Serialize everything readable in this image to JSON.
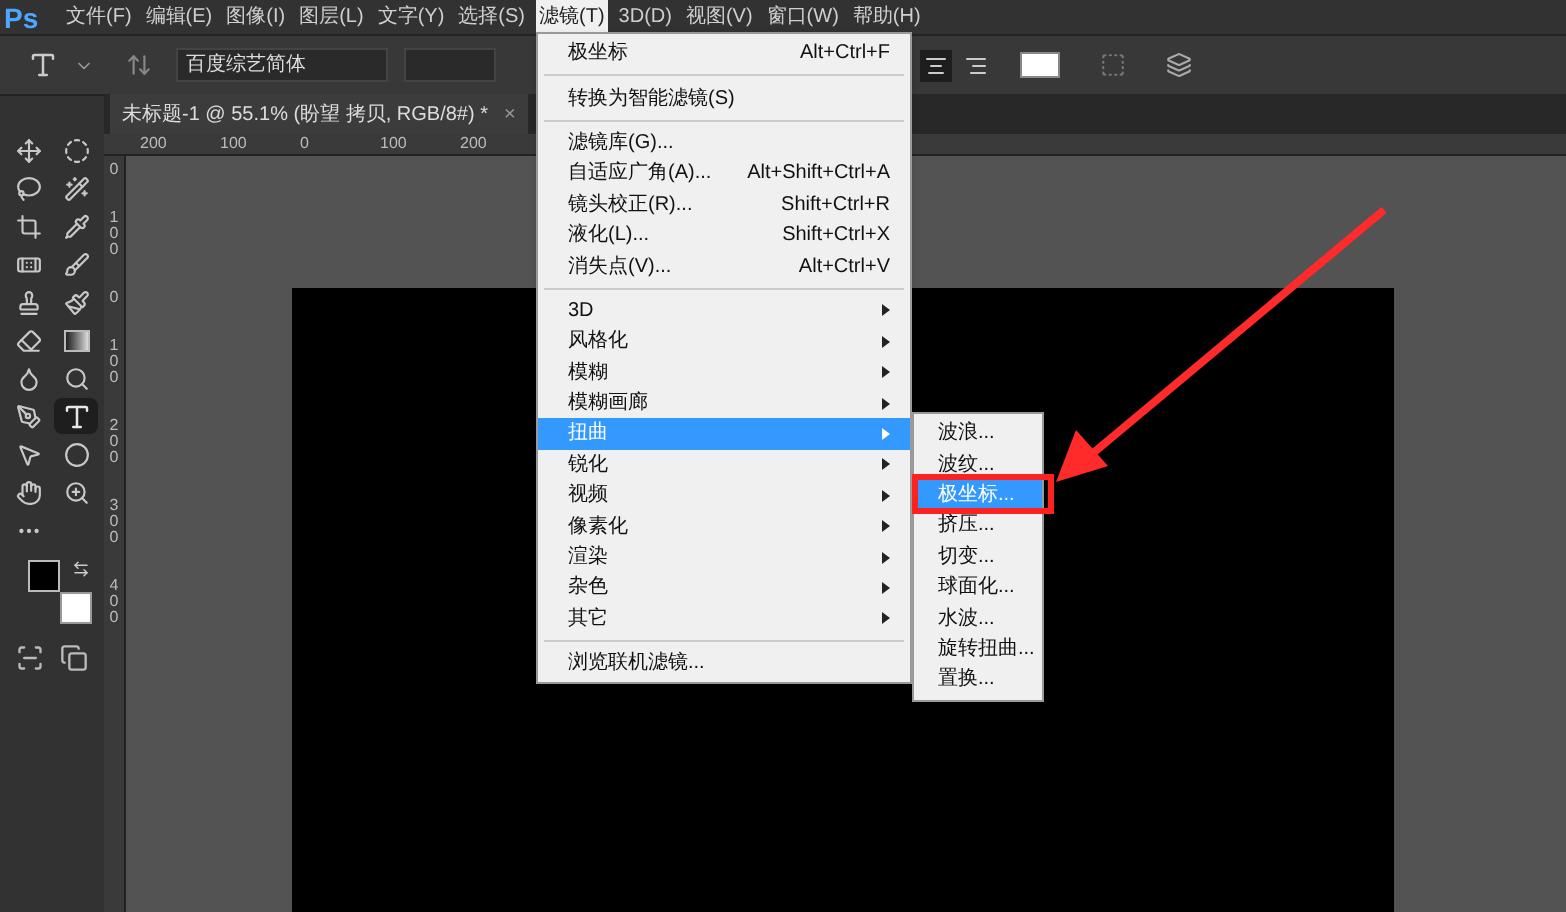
{
  "app_logo": "Ps",
  "menu_bar": [
    {
      "label": "文件(F)",
      "selected": false
    },
    {
      "label": "编辑(E)",
      "selected": false
    },
    {
      "label": "图像(I)",
      "selected": false
    },
    {
      "label": "图层(L)",
      "selected": false
    },
    {
      "label": "文字(Y)",
      "selected": false
    },
    {
      "label": "选择(S)",
      "selected": false
    },
    {
      "label": "滤镜(T)",
      "selected": true
    },
    {
      "label": "3D(D)",
      "selected": false
    },
    {
      "label": "视图(V)",
      "selected": false
    },
    {
      "label": "窗口(W)",
      "selected": false
    },
    {
      "label": "帮助(H)",
      "selected": false
    }
  ],
  "options_bar": {
    "font_family": "百度综艺简体",
    "align": [
      {
        "kind": "center",
        "selected": true
      },
      {
        "kind": "right",
        "selected": false
      }
    ]
  },
  "document_tab": {
    "title": "未标题-1 @ 55.1% (盼望 拷贝, RGB/8#) *",
    "close": "×"
  },
  "horizontal_ruler": [
    "200",
    "100",
    "0",
    "100",
    "200"
  ],
  "vertical_ruler": [
    "0",
    "100",
    "0",
    "100",
    "200",
    "300",
    "400"
  ],
  "tools": [
    {
      "kind": "move",
      "selected": false
    },
    {
      "kind": "marquee",
      "selected": false
    },
    {
      "kind": "lasso",
      "selected": false
    },
    {
      "kind": "wand",
      "selected": false
    },
    {
      "kind": "crop",
      "selected": false
    },
    {
      "kind": "eyedropper",
      "selected": false
    },
    {
      "kind": "healing",
      "selected": false
    },
    {
      "kind": "brush",
      "selected": false
    },
    {
      "kind": "stamp",
      "selected": false
    },
    {
      "kind": "history",
      "selected": false
    },
    {
      "kind": "eraser",
      "selected": false
    },
    {
      "kind": "gradient",
      "selected": false
    },
    {
      "kind": "smudge",
      "selected": false
    },
    {
      "kind": "dodge",
      "selected": false
    },
    {
      "kind": "pen",
      "selected": false
    },
    {
      "kind": "type",
      "selected": true
    },
    {
      "kind": "select",
      "selected": false
    },
    {
      "kind": "ellipse",
      "selected": false
    },
    {
      "kind": "hand",
      "selected": false
    },
    {
      "kind": "zoom",
      "selected": false
    },
    {
      "kind": "more",
      "selected": false
    }
  ],
  "filter_menu": [
    [
      {
        "label": "极坐标",
        "shortcut": "Alt+Ctrl+F",
        "submenu": false,
        "selected": false
      }
    ],
    [
      {
        "label": "转换为智能滤镜(S)",
        "submenu": false,
        "selected": false
      }
    ],
    [
      {
        "label": "滤镜库(G)...",
        "submenu": false,
        "selected": false
      },
      {
        "label": "自适应广角(A)...",
        "shortcut": "Alt+Shift+Ctrl+A",
        "submenu": false,
        "selected": false
      },
      {
        "label": "镜头校正(R)...",
        "shortcut": "Shift+Ctrl+R",
        "submenu": false,
        "selected": false
      },
      {
        "label": "液化(L)...",
        "shortcut": "Shift+Ctrl+X",
        "submenu": false,
        "selected": false
      },
      {
        "label": "消失点(V)...",
        "shortcut": "Alt+Ctrl+V",
        "submenu": false,
        "selected": false
      }
    ],
    [
      {
        "label": "3D",
        "submenu": true,
        "selected": false
      },
      {
        "label": "风格化",
        "submenu": true,
        "selected": false
      },
      {
        "label": "模糊",
        "submenu": true,
        "selected": false
      },
      {
        "label": "模糊画廊",
        "submenu": true,
        "selected": false
      },
      {
        "label": "扭曲",
        "submenu": true,
        "selected": true
      },
      {
        "label": "锐化",
        "submenu": true,
        "selected": false
      },
      {
        "label": "视频",
        "submenu": true,
        "selected": false
      },
      {
        "label": "像素化",
        "submenu": true,
        "selected": false
      },
      {
        "label": "渲染",
        "submenu": true,
        "selected": false
      },
      {
        "label": "杂色",
        "submenu": true,
        "selected": false
      },
      {
        "label": "其它",
        "submenu": true,
        "selected": false
      }
    ],
    [
      {
        "label": "浏览联机滤镜...",
        "submenu": false,
        "selected": false
      }
    ]
  ],
  "distort_submenu": [
    {
      "label": "波浪...",
      "selected": false
    },
    {
      "label": "波纹...",
      "selected": false
    },
    {
      "label": "极坐标...",
      "selected": true
    },
    {
      "label": "挤压...",
      "selected": false
    },
    {
      "label": "切变...",
      "selected": false
    },
    {
      "label": "球面化...",
      "selected": false
    },
    {
      "label": "水波...",
      "selected": false
    },
    {
      "label": "旋转扭曲...",
      "selected": false
    },
    {
      "label": "置换...",
      "selected": false
    }
  ]
}
